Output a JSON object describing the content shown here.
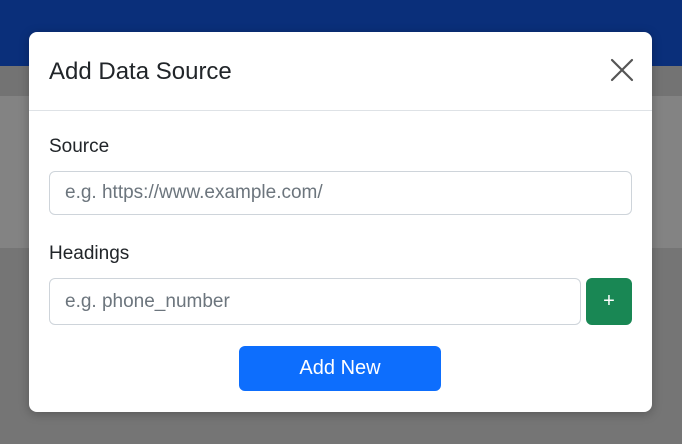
{
  "modal": {
    "title": "Add Data Source",
    "close_icon": "close-icon",
    "source": {
      "label": "Source",
      "value": "",
      "placeholder": "e.g. https://www.example.com/"
    },
    "headings": {
      "label": "Headings",
      "value": "",
      "placeholder": "e.g. phone_number",
      "add_label": "+"
    },
    "submit_label": "Add New"
  },
  "colors": {
    "navbar": "#0a2f7a",
    "success": "#198754",
    "primary": "#0d6efd"
  }
}
